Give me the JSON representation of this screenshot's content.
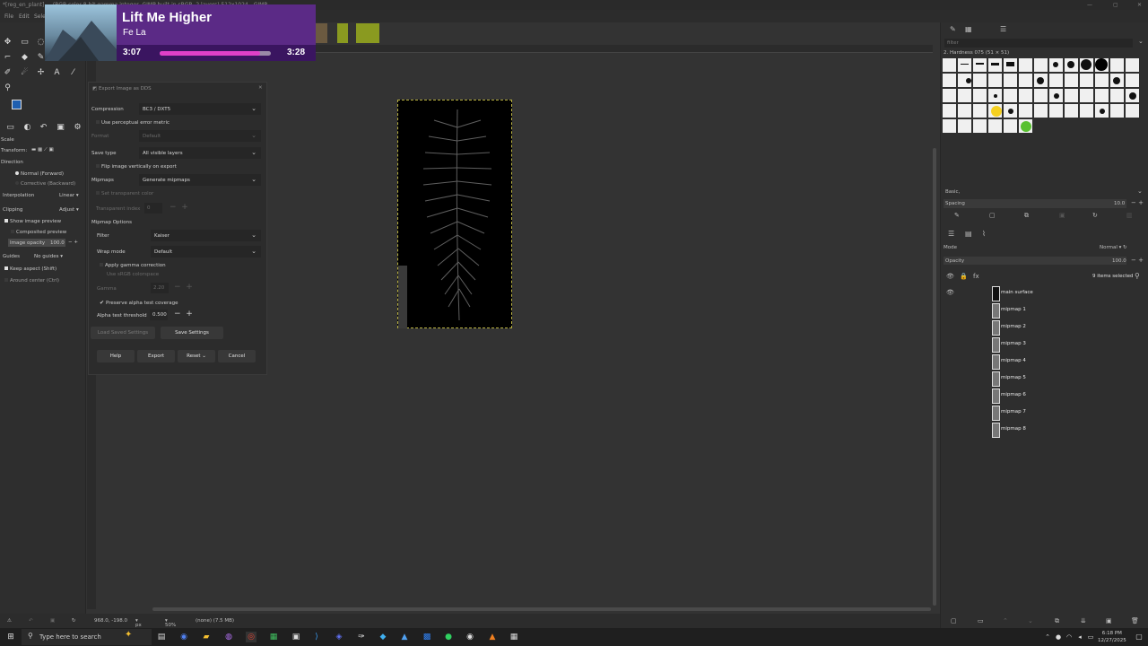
{
  "window": {
    "title": "*[reg_en_plant] ... (RGB color 8-bit gamma integer, GIMP built-in sRGB, 2 layers) 512x1024 - GIMP"
  },
  "menubar": {
    "items": [
      "File",
      "Edit",
      "Select"
    ]
  },
  "media": {
    "title": "Lift Me Higher",
    "artist": "Fe La",
    "elapsed": "3:07",
    "total": "3:28",
    "progress_fraction": 0.9
  },
  "toolbox": {
    "section_scale": "Scale",
    "transform_label": "Transform:",
    "direction_label": "Direction",
    "direction_options": [
      "Normal (Forward)",
      "Corrective (Backward)"
    ],
    "interpolation_label": "Interpolation",
    "interpolation_value": "Linear",
    "clipping_label": "Clipping",
    "clipping_value": "Adjust",
    "show_preview": "Show image preview",
    "composited_preview": "Composited preview",
    "image_opacity_label": "Image opacity",
    "image_opacity_value": "100.0",
    "guides_label": "Guides",
    "guides_value": "No guides",
    "keep_aspect": "Keep aspect (Shift)",
    "around_center": "Around center (Ctrl)"
  },
  "dialog": {
    "title": "Export Image as DDS",
    "compression_label": "Compression",
    "compression_value": "BC3 / DXT5",
    "perceptual_label": "Use perceptual error metric",
    "format_label": "Format",
    "format_value": "Default",
    "save_type_label": "Save type",
    "save_type_value": "All visible layers",
    "flip_label": "Flip image vertically on export",
    "mipmaps_label": "Mipmaps",
    "mipmaps_value": "Generate mipmaps",
    "transparent_color_label": "Set transparent color",
    "transparent_index_label": "Transparent index",
    "transparent_index_value": "0",
    "mipmap_options_label": "Mipmap Options",
    "filter_label": "Filter",
    "filter_value": "Kaiser",
    "wrap_label": "Wrap mode",
    "wrap_value": "Default",
    "gamma_correction_label": "Apply gamma correction",
    "srgb_label": "Use sRGB colorspace",
    "gamma_label": "Gamma",
    "gamma_value": "2.20",
    "preserve_alpha_label": "Preserve alpha test coverage",
    "alpha_threshold_label": "Alpha test threshold",
    "alpha_threshold_value": "0.500",
    "load_settings": "Load Saved Settings",
    "save_settings": "Save Settings",
    "help": "Help",
    "export": "Export",
    "reset": "Reset",
    "cancel": "Cancel"
  },
  "statusbar": {
    "coords": "968.0, -198.0",
    "unit": "px",
    "zoom": "50%",
    "info": "(none) (7.5 MB)"
  },
  "brushes": {
    "filter_placeholder": "filter",
    "current": "2. Hardness 075 (51 × 51)",
    "tag_value": "Basic,",
    "spacing_label": "Spacing",
    "spacing_value": "10.0"
  },
  "layers": {
    "mode_label": "Mode",
    "mode_value": "Normal",
    "opacity_label": "Opacity",
    "opacity_value": "100.0",
    "selected_info": "9 items selected",
    "items": [
      "main surface",
      "mipmap 1",
      "mipmap 2",
      "mipmap 3",
      "mipmap 4",
      "mipmap 5",
      "mipmap 6",
      "mipmap 7",
      "mipmap 8"
    ]
  },
  "taskbar": {
    "search_placeholder": "Type here to search",
    "time": "6:18 PM",
    "date": "12/27/2025"
  }
}
